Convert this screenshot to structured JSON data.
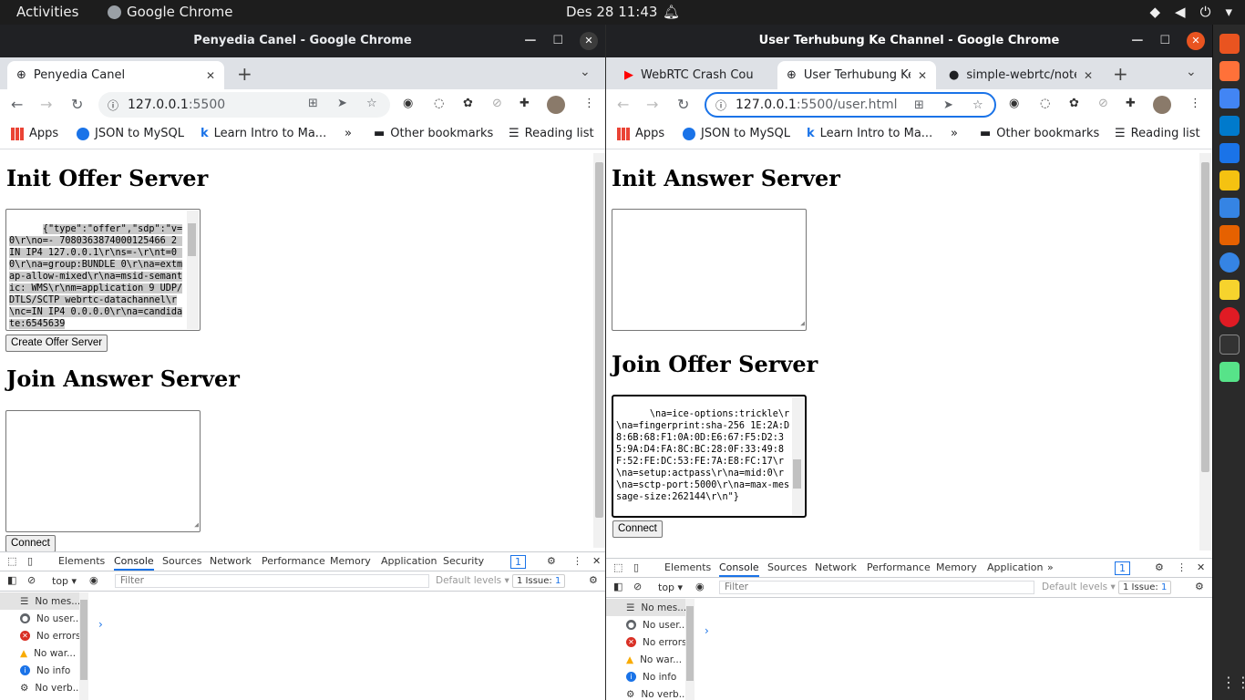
{
  "topbar": {
    "activities": "Activities",
    "app": "Google Chrome",
    "clock": "Des 28  11:43"
  },
  "left": {
    "title": "Penyedia Canel - Google Chrome",
    "tab": "Penyedia Canel",
    "url_host": "127.0.0.1",
    "url_path": ":5500",
    "bookmarks": [
      "Apps",
      "JSON to MySQL",
      "Learn Intro to Ma...",
      "»",
      "Other bookmarks",
      "Reading list"
    ],
    "h_offer": "Init Offer Server",
    "offer_text": "{\"type\":\"offer\",\"sdp\":\"v=0\\r\\no=- 7080363874000125466 2 IN IP4 127.0.0.1\\r\\ns=-\\r\\nt=0 0\\r\\na=group:BUNDLE 0\\r\\na=extmap-allow-mixed\\r\\na=msid-semantic: WMS\\r\\nm=application 9 UDP/DTLS/SCTP webrtc-datachannel\\r\\nc=IN IP4 0.0.0.0\\r\\na=candidate:6545639",
    "btn_create": "Create Offer Server",
    "h_answer": "Join Answer Server",
    "btn_connect": "Connect"
  },
  "right": {
    "title": "User Terhubung Ke Channel - Google Chrome",
    "tabs": [
      "WebRTC Crash Cou",
      "User Terhubung Ke",
      "simple-webrtc/note"
    ],
    "url_host": "127.0.0.1",
    "url_path": ":5500/user.html",
    "bookmarks": [
      "Apps",
      "JSON to MySQL",
      "Learn Intro to Ma...",
      "»",
      "Other bookmarks",
      "Reading list"
    ],
    "h_answer": "Init Answer Server",
    "h_offer": "Join Offer Server",
    "offer_text": "\\na=ice-options:trickle\\r\\na=fingerprint:sha-256 1E:2A:D8:6B:68:F1:0A:0D:E6:67:F5:D2:35:9A:D4:FA:8C:BC:28:0F:33:49:8F:52:FE:DC:53:FE:7A:E8:FC:17\\r\\na=setup:actpass\\r\\na=mid:0\\r\\na=sctp-port:5000\\r\\na=max-message-size:262144\\r\\n\"}",
    "btn_connect": "Connect"
  },
  "devtools": {
    "tabs": [
      "Elements",
      "Console",
      "Sources",
      "Network",
      "Performance",
      "Memory",
      "Application",
      "Security"
    ],
    "right_tabs": [
      "Elements",
      "Console",
      "Sources",
      "Network",
      "Performance",
      "Memory",
      "Application",
      "»"
    ],
    "issue_badge": "1",
    "context": "top",
    "filter_placeholder": "Filter",
    "levels": "Default levels",
    "issue_text": "1 Issue:",
    "issue_count": "1",
    "sidebar": [
      "No mes...",
      "No user...",
      "No errors",
      "No war...",
      "No info",
      "No verb..."
    ],
    "prompt": "›"
  }
}
